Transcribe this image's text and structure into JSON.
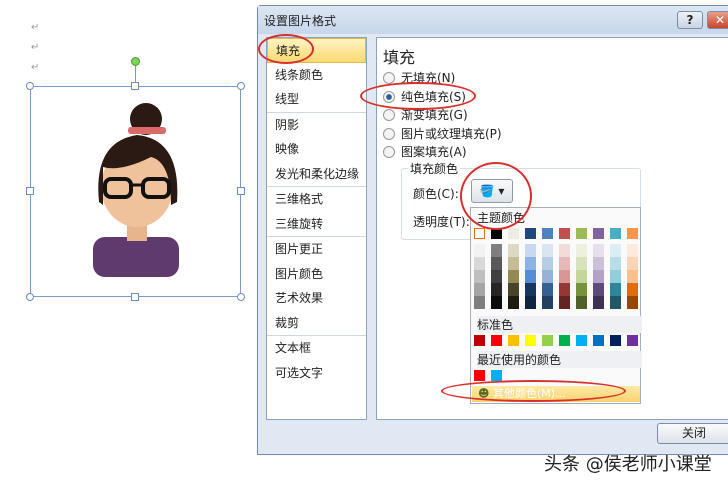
{
  "doc": {
    "para_mark": "↵"
  },
  "dialog": {
    "title": "设置图片格式",
    "help": "?",
    "close_x": "✕",
    "close_button": "关闭"
  },
  "sidebar": {
    "items": [
      {
        "label": "填充",
        "selected": true
      },
      {
        "label": "线条颜色"
      },
      {
        "label": "线型"
      },
      {
        "label": "阴影"
      },
      {
        "label": "映像"
      },
      {
        "label": "发光和柔化边缘"
      },
      {
        "label": "三维格式"
      },
      {
        "label": "三维旋转"
      },
      {
        "label": "图片更正"
      },
      {
        "label": "图片颜色"
      },
      {
        "label": "艺术效果"
      },
      {
        "label": "裁剪"
      },
      {
        "label": "文本框"
      },
      {
        "label": "可选文字"
      }
    ]
  },
  "fill": {
    "heading": "填充",
    "options": [
      {
        "label": "无填充(N)",
        "checked": false
      },
      {
        "label": "纯色填充(S)",
        "checked": true
      },
      {
        "label": "渐变填充(G)",
        "checked": false
      },
      {
        "label": "图片或纹理填充(P)",
        "checked": false
      },
      {
        "label": "图案填充(A)",
        "checked": false
      }
    ],
    "group_label": "填充颜色",
    "color_label": "颜色(C):",
    "transparency_label": "透明度(T):"
  },
  "palette": {
    "theme_label": "主题颜色",
    "standard_label": "标准色",
    "recent_label": "最近使用的颜色",
    "more_colors": "其他颜色(M)...",
    "theme": [
      "#ffffff",
      "#000000",
      "#eeece1",
      "#1f497d",
      "#4f81bd",
      "#c0504d",
      "#9bbb59",
      "#8064a2",
      "#4bacc6",
      "#f79646"
    ],
    "shades": [
      [
        "#f2f2f2",
        "#d8d8d8",
        "#bfbfbf",
        "#a5a5a5",
        "#7f7f7f"
      ],
      [
        "#7f7f7f",
        "#595959",
        "#3f3f3f",
        "#262626",
        "#0c0c0c"
      ],
      [
        "#ddd9c3",
        "#c4bd97",
        "#938953",
        "#494429",
        "#1d1b10"
      ],
      [
        "#c6d9f0",
        "#8db3e2",
        "#548dd4",
        "#17365d",
        "#0f243e"
      ],
      [
        "#dbe5f1",
        "#b8cce4",
        "#95b3d7",
        "#366092",
        "#244061"
      ],
      [
        "#f2dcdb",
        "#e5b9b7",
        "#d99694",
        "#953734",
        "#632423"
      ],
      [
        "#ebf1dd",
        "#d7e3bc",
        "#c3d69b",
        "#76923c",
        "#4f6128"
      ],
      [
        "#e5e0ec",
        "#ccc1d9",
        "#b2a2c7",
        "#5f497a",
        "#3f3151"
      ],
      [
        "#dbeef3",
        "#b7dde8",
        "#92cddc",
        "#31859b",
        "#205867"
      ],
      [
        "#fdeada",
        "#fbd5b5",
        "#fac08f",
        "#e36c09",
        "#974806"
      ]
    ],
    "standard": [
      "#c00000",
      "#ff0000",
      "#ffc000",
      "#ffff00",
      "#92d050",
      "#00b050",
      "#00b0f0",
      "#0070c0",
      "#002060",
      "#7030a0"
    ],
    "recent": [
      "#ff0000",
      "#00b0f0"
    ]
  },
  "watermark": "头条 @侯老师小课堂"
}
